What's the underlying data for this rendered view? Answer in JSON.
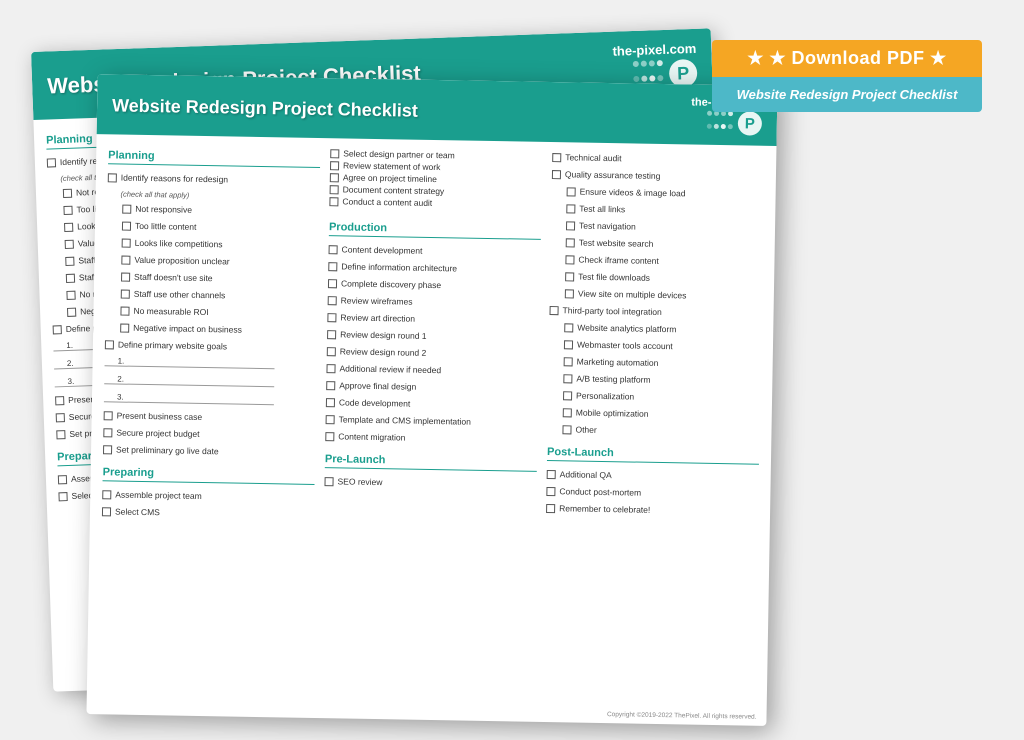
{
  "scene": {
    "background": "#f0f0f0"
  },
  "download_badge": {
    "top_text": "★ Download PDF ★",
    "bottom_text": "Website Redesign Project Checklist"
  },
  "card": {
    "header": {
      "title": "Website Redesign Project Checklist",
      "domain": "the-pixel.com"
    },
    "copyright": "Copyright ©2019-2022 ThePixel. All rights reserved.",
    "sections": {
      "planning": {
        "title": "Planning",
        "items": [
          "Identify reasons for redesign",
          "(check all that apply)",
          "Not responsive",
          "Too little content",
          "Looks like competitions",
          "Value proposition unclear",
          "Staff doesn't use site",
          "Staff use other channels",
          "No measurable ROI",
          "Negative impact on business",
          "Define primary website goals",
          "1.",
          "2.",
          "3.",
          "Present business case",
          "Secure project budget",
          "Set preliminary go live date"
        ]
      },
      "preparing": {
        "title": "Preparing",
        "items": [
          "Assemble project team",
          "Select CMS",
          "Select design partner or team",
          "Review statement of work",
          "Agree on project timeline",
          "Document content strategy",
          "Conduct a content audit"
        ]
      },
      "production": {
        "title": "Production",
        "items": [
          "Content development",
          "Define information architecture",
          "Complete discovery phase",
          "Review wireframes",
          "Review art direction",
          "Review design round 1",
          "Review design round 2",
          "Additional review if needed",
          "Approve final design",
          "Code development",
          "Template and CMS implementation",
          "Content migration"
        ]
      },
      "pre_launch": {
        "title": "Pre-Launch",
        "items": [
          "SEO review",
          "Technical audit",
          "Quality assurance testing",
          "Ensure videos & image load",
          "Test all links",
          "Test navigation",
          "Test website search",
          "Check iframe content",
          "Test file downloads",
          "View site on multiple devices",
          "Third-party tool integration",
          "Website analytics platform",
          "Webmaster tools account",
          "Marketing automation",
          "A/B testing platform",
          "Personalization",
          "Mobile optimization",
          "Other"
        ]
      },
      "post_launch": {
        "title": "Post-Launch",
        "items": [
          "Additional QA",
          "Conduct post-mortem",
          "Remember to celebrate!"
        ]
      }
    }
  }
}
